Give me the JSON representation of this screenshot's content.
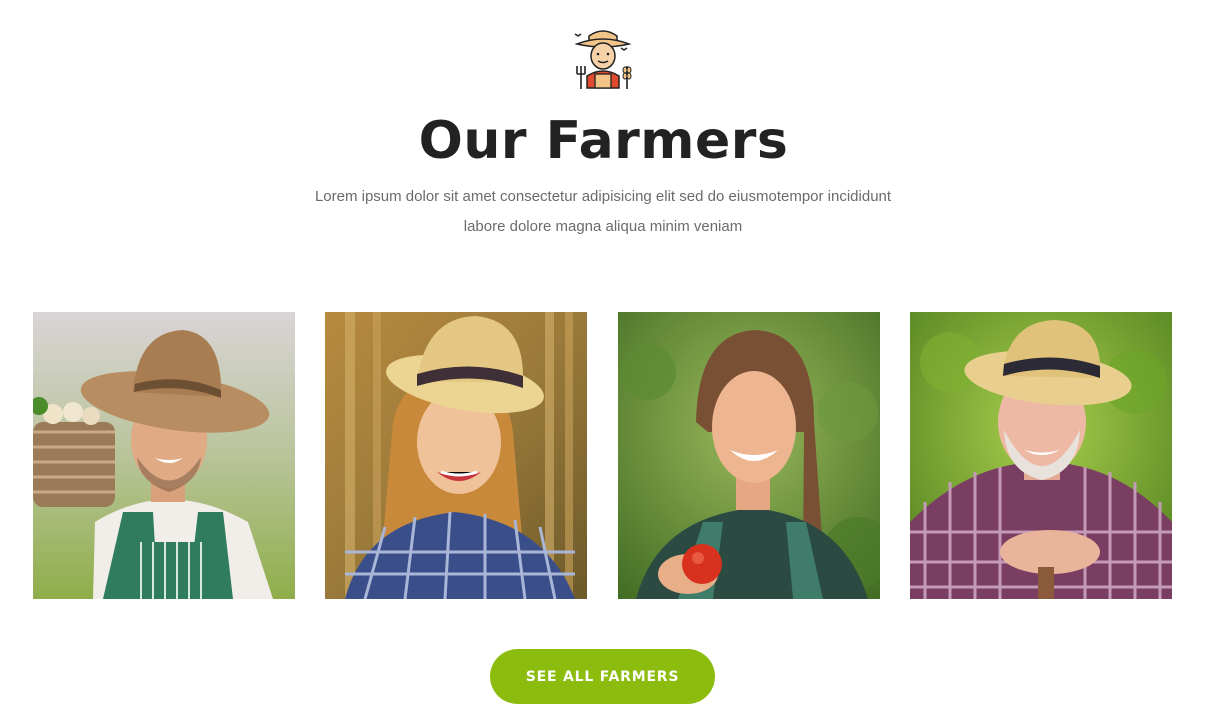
{
  "section": {
    "title": "Our Farmers",
    "description": "Lorem ipsum dolor sit amet consectetur adipisicing elit sed do eiusmotempor incididunt labore dolore magna aliqua minim veniam",
    "icon": "farmer-icon"
  },
  "farmers": [
    {
      "photo": "young man with hat, basket and striped apron"
    },
    {
      "photo": "young woman with straw hat and plaid shirt"
    },
    {
      "photo": "woman with ponytail holding a tomato"
    },
    {
      "photo": "elderly man with straw hat and plaid shirt"
    }
  ],
  "cta": {
    "label": "SEE ALL FARMERS"
  },
  "colors": {
    "accent": "#8bbc0e",
    "title": "#222222",
    "text": "#6b6b6b"
  }
}
